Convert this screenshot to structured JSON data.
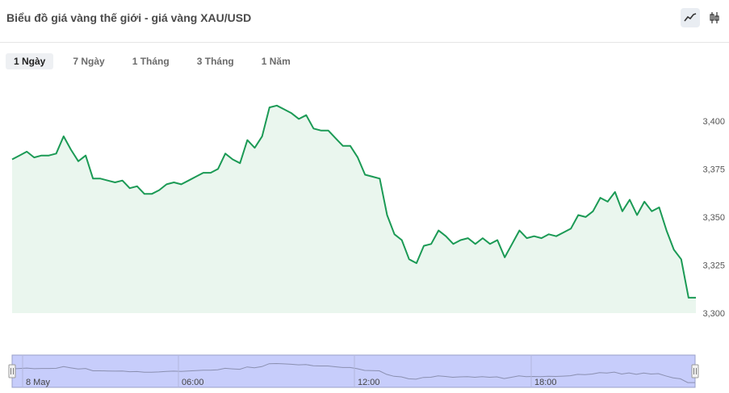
{
  "header": {
    "title": "Biểu đồ giá vàng thế giới - giá vàng XAU/USD"
  },
  "chart_type_buttons": [
    {
      "name": "line-chart-icon",
      "active": true
    },
    {
      "name": "candlestick-icon",
      "active": false
    }
  ],
  "tabs": [
    {
      "label": "1 Ngày",
      "active": true
    },
    {
      "label": "7 Ngày",
      "active": false
    },
    {
      "label": "1 Tháng",
      "active": false
    },
    {
      "label": "3 Tháng",
      "active": false
    },
    {
      "label": "1 Năm",
      "active": false
    }
  ],
  "colors": {
    "line": "#1b9a55",
    "fill": "#eaf6ee",
    "navigator_fill": "#c7cdfb",
    "navigator_line": "#8a8fb0"
  },
  "chart_data": {
    "type": "area",
    "title": "Biểu đồ giá vàng thế giới - giá vàng XAU/USD",
    "ylim": [
      3300,
      3410
    ],
    "yticks": [
      3300,
      3325,
      3350,
      3375,
      3400
    ],
    "ytick_labels": [
      "3,300",
      "3,325",
      "3,350",
      "3,375",
      "3,400"
    ],
    "grid": false,
    "series": [
      {
        "values": [
          3380,
          3382,
          3384,
          3381,
          3382,
          3382,
          3383,
          3392,
          3385,
          3379,
          3382,
          3370,
          3370,
          3369,
          3368,
          3369,
          3365,
          3366,
          3362,
          3362,
          3364,
          3367,
          3368,
          3367,
          3369,
          3371,
          3373,
          3373,
          3375,
          3383,
          3380,
          3378,
          3390,
          3386,
          3392,
          3407,
          3408,
          3406,
          3404,
          3401,
          3403,
          3396,
          3395,
          3395,
          3391,
          3387,
          3387,
          3381,
          3372,
          3371,
          3370,
          3351,
          3341,
          3338,
          3328,
          3326,
          3335,
          3336,
          3343,
          3340,
          3336,
          3338,
          3339,
          3336,
          3339,
          3336,
          3338,
          3329,
          3336,
          3343,
          3339,
          3340,
          3339,
          3341,
          3340,
          3342,
          3344,
          3351,
          3350,
          3353,
          3360,
          3358,
          3363,
          3353,
          3359,
          3351,
          3358,
          3353,
          3355,
          3343,
          3333,
          3328,
          3308,
          3308
        ]
      }
    ],
    "navigator": {
      "labels": [
        "8 May",
        "06:00",
        "12:00",
        "18:00"
      ]
    }
  }
}
